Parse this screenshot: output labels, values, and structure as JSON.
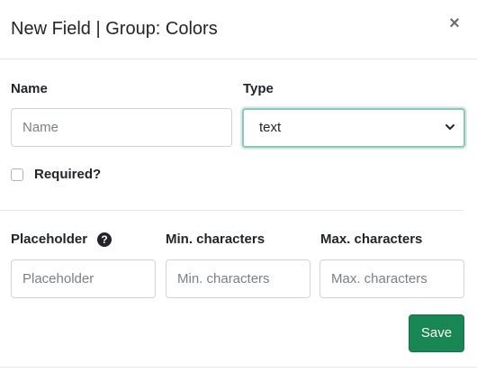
{
  "modal": {
    "title": "New Field | Group: Colors",
    "close_symbol": "×"
  },
  "fields": {
    "name": {
      "label": "Name",
      "placeholder": "Name",
      "value": ""
    },
    "type": {
      "label": "Type",
      "selected": "text"
    },
    "required": {
      "label": "Required?",
      "checked": false
    },
    "placeholder": {
      "label": "Placeholder",
      "placeholder": "Placeholder",
      "value": ""
    },
    "min_chars": {
      "label": "Min. characters",
      "placeholder": "Min. characters",
      "value": ""
    },
    "max_chars": {
      "label": "Max. characters",
      "placeholder": "Max. characters",
      "value": ""
    }
  },
  "help_icon_symbol": "?",
  "actions": {
    "save_label": "Save"
  },
  "colors": {
    "primary": "#198754",
    "focus_border": "#8fc7b6",
    "border": "#ced4da",
    "text": "#212529"
  },
  "icons": [
    "close-icon",
    "chevron-down-icon",
    "question-circle-icon"
  ]
}
